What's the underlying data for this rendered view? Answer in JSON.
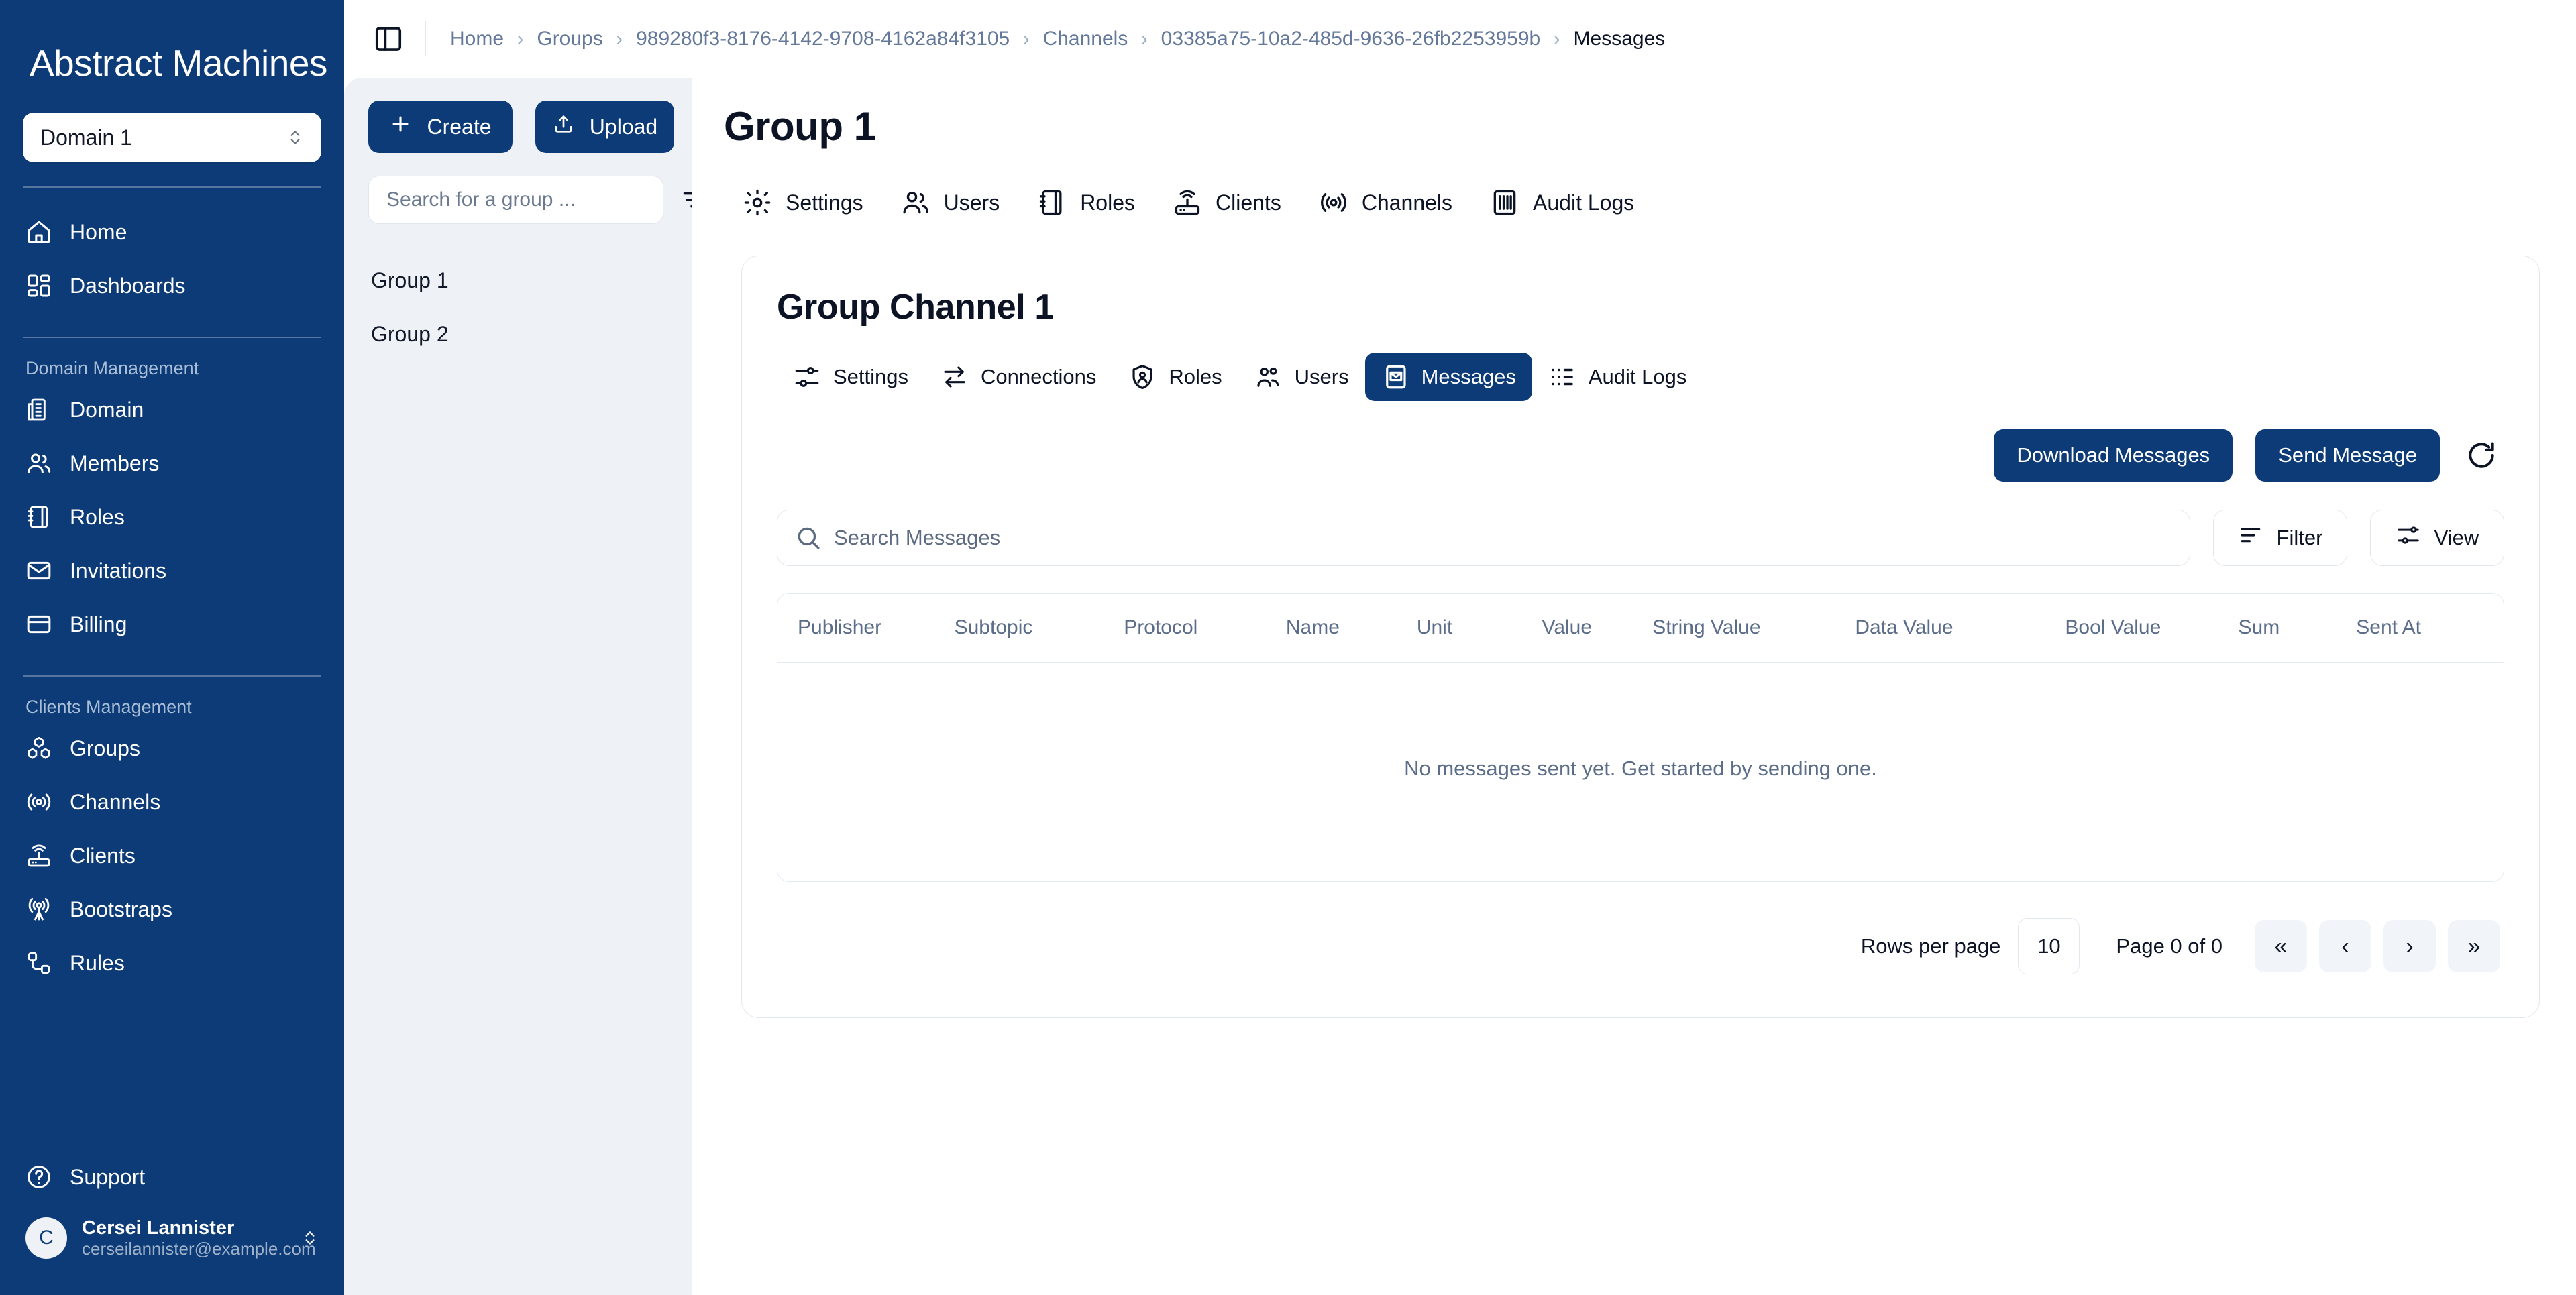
{
  "sidebar": {
    "brand": "Abstract Machines",
    "domain_selector": {
      "value": "Domain 1",
      "icon": "chevron-up-down-icon"
    },
    "top_items": [
      {
        "label": "Home",
        "icon": "home-icon"
      },
      {
        "label": "Dashboards",
        "icon": "dashboards-grid-icon"
      }
    ],
    "sections": [
      {
        "caption": "Domain Management",
        "items": [
          {
            "label": "Domain",
            "icon": "building-icon"
          },
          {
            "label": "Members",
            "icon": "users-icon"
          },
          {
            "label": "Roles",
            "icon": "notebook-icon"
          },
          {
            "label": "Invitations",
            "icon": "envelope-icon"
          },
          {
            "label": "Billing",
            "icon": "credit-card-icon"
          }
        ]
      },
      {
        "caption": "Clients Management",
        "items": [
          {
            "label": "Groups",
            "icon": "boxes-icon"
          },
          {
            "label": "Channels",
            "icon": "broadcast-icon"
          },
          {
            "label": "Clients",
            "icon": "router-icon"
          },
          {
            "label": "Bootstraps",
            "icon": "antenna-icon"
          },
          {
            "label": "Rules",
            "icon": "nodes-icon"
          }
        ]
      }
    ],
    "support": {
      "label": "Support",
      "icon": "question-circle-icon"
    },
    "profile": {
      "initial": "C",
      "name": "Cersei Lannister",
      "email": "cerseilannister@example.com",
      "icon": "chevron-up-down-icon"
    }
  },
  "topbar": {
    "toggle_icon": "panel-left-icon",
    "breadcrumb": [
      {
        "label": "Home",
        "current": false
      },
      {
        "label": "Groups",
        "current": false
      },
      {
        "label": "989280f3-8176-4142-9708-4162a84f3105",
        "current": false
      },
      {
        "label": "Channels",
        "current": false
      },
      {
        "label": "03385a75-10a2-485d-9636-26fb2253959b",
        "current": false
      },
      {
        "label": "Messages",
        "current": true
      }
    ],
    "separator": "›"
  },
  "group_panel": {
    "create_label": "Create",
    "upload_label": "Upload",
    "search_placeholder": "Search for a group ...",
    "search_value": "",
    "filter_icon": "filter-icon",
    "groups": [
      {
        "label": "Group 1"
      },
      {
        "label": "Group 2"
      }
    ]
  },
  "main": {
    "title": "Group 1",
    "tabs": [
      {
        "label": "Settings",
        "icon": "gear-icon",
        "active": false
      },
      {
        "label": "Users",
        "icon": "users-icon",
        "active": false
      },
      {
        "label": "Roles",
        "icon": "notebook-icon",
        "active": false
      },
      {
        "label": "Clients",
        "icon": "router-icon",
        "active": false
      },
      {
        "label": "Channels",
        "icon": "broadcast-icon",
        "active": false
      },
      {
        "label": "Audit Logs",
        "icon": "audit-icon",
        "active": false
      }
    ]
  },
  "channel_card": {
    "title": "Group Channel 1",
    "tabs": [
      {
        "label": "Settings",
        "icon": "sliders-icon",
        "active": false
      },
      {
        "label": "Connections",
        "icon": "arrows-exchange-icon",
        "active": false
      },
      {
        "label": "Roles",
        "icon": "shield-user-icon",
        "active": false
      },
      {
        "label": "Users",
        "icon": "users-icon",
        "active": false
      },
      {
        "label": "Messages",
        "icon": "message-mail-icon",
        "active": true
      },
      {
        "label": "Audit Logs",
        "icon": "list-dots-icon",
        "active": false
      }
    ],
    "actions": {
      "download_label": "Download Messages",
      "send_label": "Send Message",
      "refresh_icon": "refresh-icon"
    },
    "toolbar": {
      "search_placeholder": "Search Messages",
      "search_value": "",
      "search_icon": "search-icon",
      "filter_label": "Filter",
      "filter_icon": "filter-lines-icon",
      "view_label": "View",
      "view_icon": "sliders-icon"
    },
    "table": {
      "columns": [
        "Publisher",
        "Subtopic",
        "Protocol",
        "Name",
        "Unit",
        "Value",
        "String Value",
        "Data Value",
        "Bool Value",
        "Sum",
        "Sent At"
      ],
      "rows": [],
      "empty_message": "No messages sent yet. Get started by sending one."
    },
    "pagination": {
      "rows_per_page_label": "Rows per page",
      "rows_per_page_value": "10",
      "page_label": "Page 0 of 0",
      "first": "«",
      "prev": "‹",
      "next": "›",
      "last": "»"
    }
  },
  "colors": {
    "brand_blue": "#0d3b77",
    "panel_bg": "#eef2f7",
    "border": "#e3e8ef",
    "muted_text": "#5b6d88",
    "crumb_text": "#64789a"
  }
}
